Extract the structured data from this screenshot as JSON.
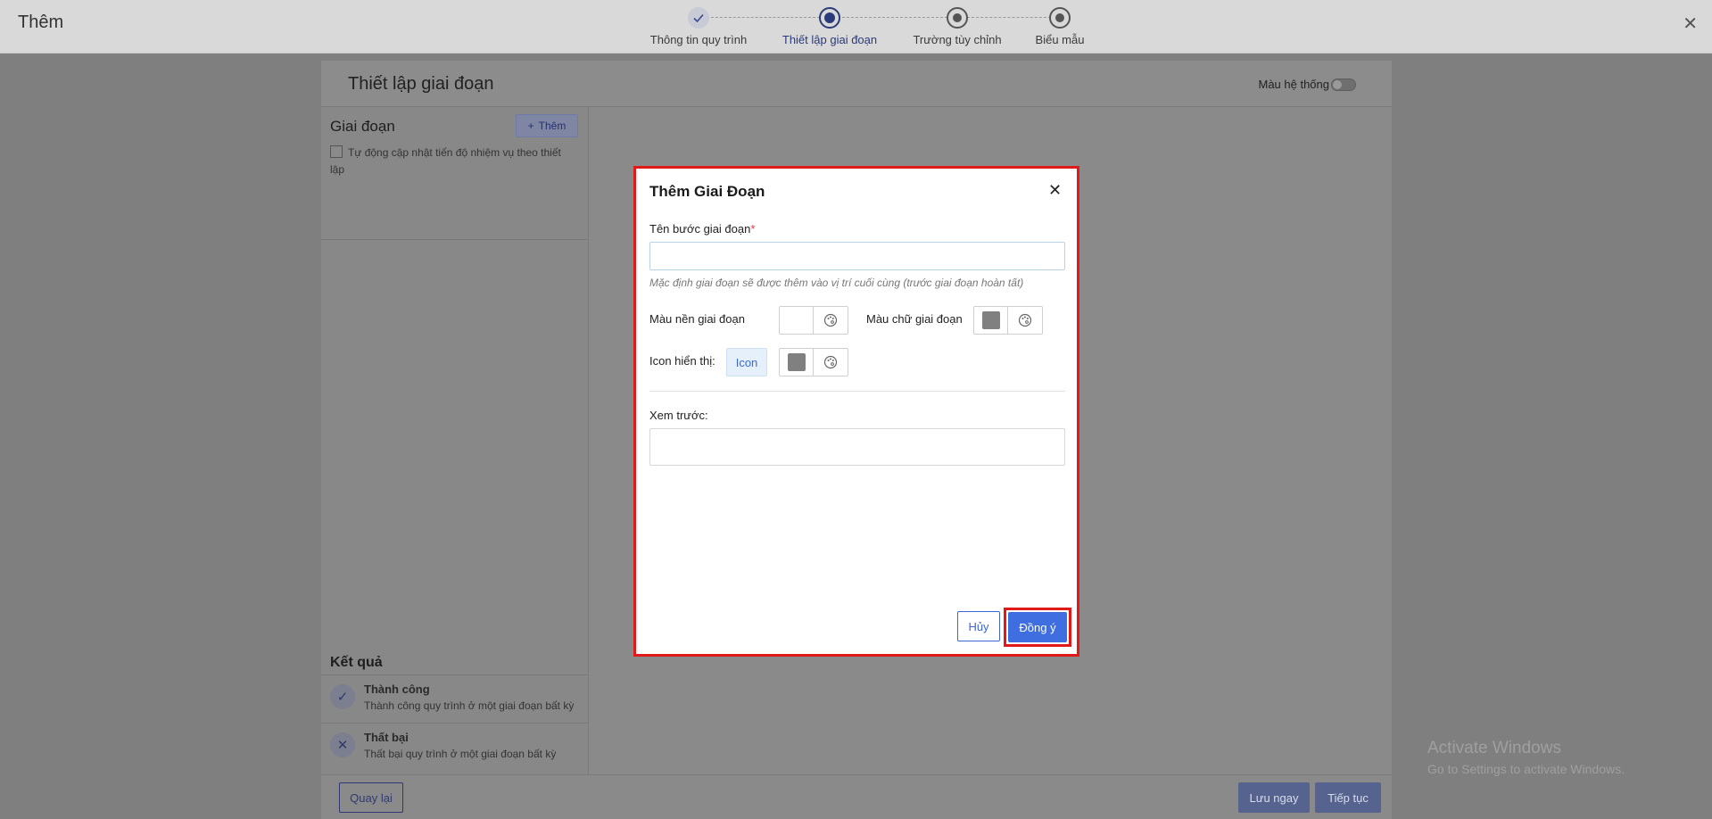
{
  "header": {
    "title": "Thêm",
    "steps": [
      {
        "label": "Thông tin quy trình",
        "state": "done"
      },
      {
        "label": "Thiết lập giai đoạn",
        "state": "active"
      },
      {
        "label": "Trường tùy chỉnh",
        "state": "pending"
      },
      {
        "label": "Biểu mẫu",
        "state": "pending"
      }
    ]
  },
  "panel": {
    "title": "Thiết lập giai đoạn",
    "system_color_label": "Màu hệ thống",
    "system_color_on": false
  },
  "sidebar": {
    "title": "Giai đoạn",
    "add_label": "Thêm",
    "auto_update_label": "Tự động cập nhật tiến độ nhiệm vụ theo thiết lập",
    "auto_update_checked": false,
    "result_title": "Kết quả",
    "results": [
      {
        "name": "Thành công",
        "desc": "Thành công quy trình ở một giai đoạn bất kỳ",
        "icon": "check-circle-icon"
      },
      {
        "name": "Thất bại",
        "desc": "Thất bại quy trình ở một giai đoạn bất kỳ",
        "icon": "x-circle-icon"
      }
    ]
  },
  "footer": {
    "back_label": "Quay lại",
    "save_now_label": "Lưu ngay",
    "continue_label": "Tiếp tục"
  },
  "modal": {
    "title": "Thêm Giai Đoạn",
    "name_label": "Tên bước giai đoạn",
    "name_value": "",
    "name_required_mark": "*",
    "hint": "Mặc định giai đoạn sẽ được thêm vào vị trí cuối cùng (trước giai đoạn hoàn tất)",
    "bg_color_label": "Màu nền giai đoạn",
    "bg_color": "#ffffff",
    "text_color_label": "Màu chữ giai đoạn",
    "text_color": "#808080",
    "icon_label": "Icon hiển thị:",
    "icon_button_label": "Icon",
    "icon_color": "#808080",
    "preview_label": "Xem trước:",
    "cancel_label": "Hủy",
    "ok_label": "Đồng ý"
  },
  "watermark": {
    "line1": "Activate Windows",
    "line2": "Go to Settings to activate Windows."
  },
  "colors": {
    "accent": "#3f6ee0",
    "highlight": "#e11919"
  }
}
